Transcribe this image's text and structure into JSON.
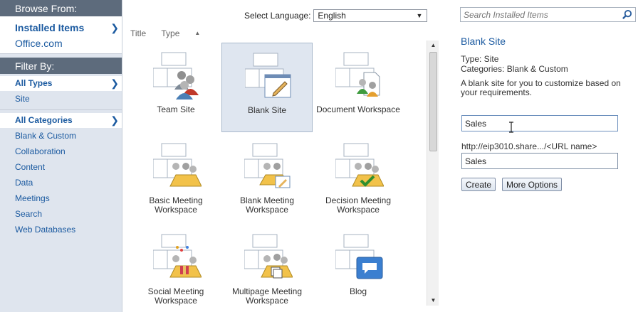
{
  "sidebar": {
    "browse_header": "Browse From:",
    "browse_items": [
      {
        "label": "Installed Items",
        "selected": true
      },
      {
        "label": "Office.com",
        "selected": false
      }
    ],
    "filter_header": "Filter By:",
    "types": [
      {
        "label": "All Types",
        "selected": true
      },
      {
        "label": "Site",
        "selected": false
      }
    ],
    "categories": [
      {
        "label": "All Categories",
        "selected": true
      },
      {
        "label": "Blank & Custom"
      },
      {
        "label": "Collaboration"
      },
      {
        "label": "Content"
      },
      {
        "label": "Data"
      },
      {
        "label": "Meetings"
      },
      {
        "label": "Search"
      },
      {
        "label": "Web Databases"
      }
    ]
  },
  "language": {
    "label": "Select Language:",
    "value": "English"
  },
  "sort": {
    "title_label": "Title",
    "type_label": "Type"
  },
  "tiles": [
    {
      "label": "Team Site",
      "icon": "team-site-icon",
      "selected": false
    },
    {
      "label": "Blank Site",
      "icon": "blank-site-icon",
      "selected": true
    },
    {
      "label": "Document Workspace",
      "icon": "document-workspace-icon",
      "selected": false
    },
    {
      "label": "Basic Meeting Workspace",
      "icon": "basic-meeting-icon",
      "selected": false
    },
    {
      "label": "Blank Meeting Workspace",
      "icon": "blank-meeting-icon",
      "selected": false
    },
    {
      "label": "Decision Meeting Workspace",
      "icon": "decision-meeting-icon",
      "selected": false
    },
    {
      "label": "Social Meeting Workspace",
      "icon": "social-meeting-icon",
      "selected": false
    },
    {
      "label": "Multipage Meeting Workspace",
      "icon": "multipage-meeting-icon",
      "selected": false
    },
    {
      "label": "Blog",
      "icon": "blog-icon",
      "selected": false
    }
  ],
  "details": {
    "search_placeholder": "Search Installed Items",
    "title": "Blank Site",
    "type_line": "Type: Site",
    "categories_line": "Categories: Blank & Custom",
    "description": "A blank site for you to customize based on your requirements.",
    "title_value": "Sales",
    "url_label": "http://eip3010.share.../<URL name>",
    "url_value": "Sales",
    "create_label": "Create",
    "more_options_label": "More Options"
  },
  "colors": {
    "accent": "#1b5aa0",
    "sidebar_header": "#5d6b7c",
    "sidebar_bg": "#dfe5ee",
    "selected_tile": "#dfe6f0"
  }
}
